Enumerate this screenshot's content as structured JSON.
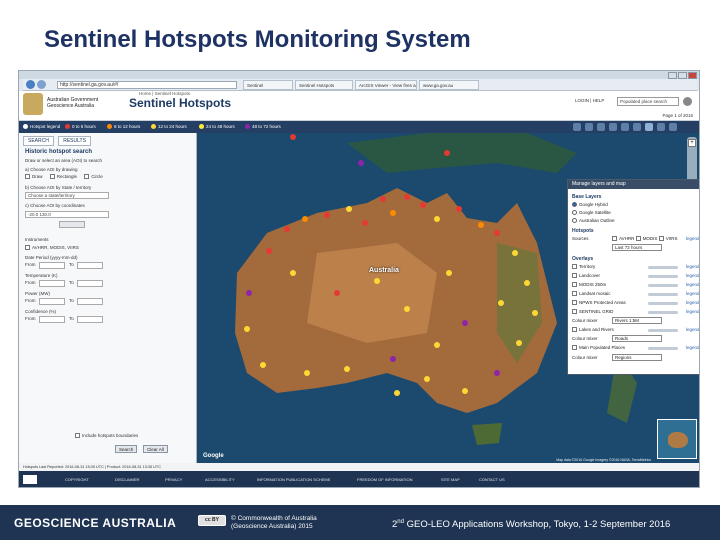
{
  "slide": {
    "title": "Sentinel Hotspots Monitoring System"
  },
  "browser": {
    "address": "http://sentinel.ga.gov.au/#/",
    "tabs": [
      "Sentinel",
      "Sentinel Hotspots",
      "ArcGIS Viewer - View fires and hotspots",
      "www.ga.gov.au"
    ]
  },
  "site": {
    "gov_text": "Australian Government\nGeoscience Australia",
    "brand": "Sentinel Hotspots",
    "breadcrumb": "Home | Sentinel Hotspots",
    "header_links": "LOGIN | HELP",
    "search_placeholder": "Populated place search",
    "date": "Page 1 of 2016"
  },
  "toolbar": {
    "items": [
      {
        "label": "Hotspot legend",
        "color": "#ffffff"
      },
      {
        "label": "0 to 6 hours",
        "color": "#e53935"
      },
      {
        "label": "6 to 12 hours",
        "color": "#fb8c00"
      },
      {
        "label": "12 to 24 hours",
        "color": "#fdd835"
      },
      {
        "label": "24 to 48 hours",
        "color": "#ffeb3b"
      },
      {
        "label": "48 to 72 hours",
        "color": "#8e24aa"
      }
    ]
  },
  "left_panel": {
    "tabs": [
      "SEARCH",
      "RESULTS"
    ],
    "heading": "Historic hotspot search",
    "hint": "Draw or select an area (AOI) to search",
    "aoi_drawing": "a) Choose AOI by drawing",
    "draw_polygon": "Draw",
    "draw_rectangle": "Rectangle",
    "draw_circle": "Circle",
    "aoi_state": "b) Choose AOI by State / territory",
    "state_placeholder": "Choose a state/territory",
    "aoi_coords": "c) Choose AOI by coordinates",
    "coord_value": "-20.0  130.0",
    "instruments_label": "Instruments",
    "instrument_values": "AVHRR, MODIS, VIIRS",
    "date_period_label": "Date Period",
    "date_period_hint": "(yyyy-mm-dd)",
    "temperature_label": "Temperature",
    "temperature_unit": "(K)",
    "power_label": "Power",
    "power_unit": "(MW)",
    "confidence_label": "Confidence",
    "confidence_unit": "(%)",
    "from_label": "From",
    "to_label": "To",
    "include_label": "Include hotspots boundaries",
    "button_search": "Search",
    "button_clear": "Clear All"
  },
  "map": {
    "country_label": "Australia",
    "google": "Google",
    "credit": "Map data ©2016 Google Imagery ©2016 NASA, TerraMetrics"
  },
  "dialog": {
    "title": "Manage layers and map",
    "base_layers_label": "Base Layers",
    "base_layers": [
      "Google Hybrid",
      "Google Satellite",
      "Australian Outline"
    ],
    "hotspots_label": "Hotspots",
    "sources_label": "Sources",
    "sources": [
      "AVHRR",
      "MODIS",
      "VIIRS"
    ],
    "hotspots_select": "Last 72 hours",
    "overlays_label": "Overlays",
    "overlays": [
      "Territory",
      "Landcover",
      "MODIS 250m",
      "Landsat mosaic",
      "NPWS Protected Areas",
      "SENTINEL GRID",
      "Fire History",
      "Lakes and Rivers",
      "Roads",
      "Main Populated Places"
    ],
    "legend_label": "legend",
    "select_colour": "Colour mixer",
    "select_value": "Rivers 1:5M",
    "select_value2": "Roads",
    "select_value3": "Regions"
  },
  "status_line": "Hotspots Last Reported: 2016-08-31 15:05 UTC | Product: 2016-08-31 13:35 UTC",
  "footer_links": [
    "COPYRIGHT",
    "DISCLAIMER",
    "PRIVACY",
    "ACCESSIBILITY",
    "INFORMATION PUBLICATION SCHEME",
    "FREEDOM OF INFORMATION",
    "SITE MAP",
    "CONTACT US"
  ],
  "banner": {
    "brand": "GEOSCIENCE AUSTRALIA",
    "cc": "cc BY",
    "copyright_line1": "© Commonwealth of Australia",
    "copyright_line2": "(Geoscience Australia) 2015",
    "event_num": "2",
    "event_sup": "nd",
    "event_rest": " GEO-LEO Applications Workshop, Tokyo, 1-2 September 2016"
  },
  "colors": {
    "brand_navy": "#1e3452",
    "title_blue": "#1e3264",
    "hotspot_red": "#e53935",
    "hotspot_yellow": "#fdd835"
  }
}
